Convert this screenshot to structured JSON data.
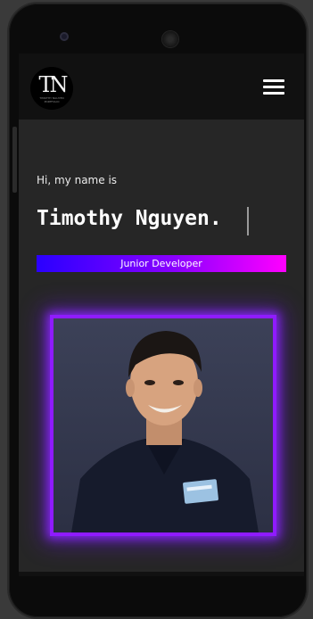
{
  "nav": {
    "logo_letters": "TN",
    "logo_subtitle": "TIMOTHY NGUYEN PORTFOLIO",
    "menu_icon": "hamburger-menu-icon"
  },
  "hero": {
    "greeting": "Hi, my name is",
    "name": "Timothy Nguyen.",
    "role": "Junior Developer"
  },
  "photo": {
    "subject": "portrait-photo"
  },
  "colors": {
    "role_gradient_start": "#2a00ff",
    "role_gradient_end": "#ff00ff",
    "frame_glow": "#8f1bff",
    "screen_bg": "#262626",
    "navbar_bg": "#111111"
  }
}
